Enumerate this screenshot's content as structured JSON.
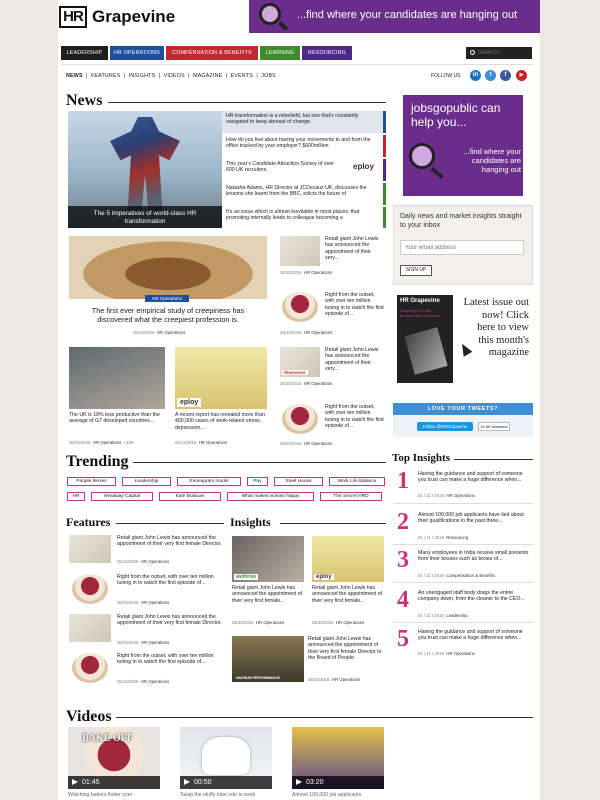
{
  "header": {
    "logo_hr": "HR",
    "logo_name": "Grapevine",
    "banner_text": "...find where your candidates are hanging out"
  },
  "nav": {
    "items": [
      "LEADERSHIP",
      "HR OPERATIONS",
      "COMPENSATION & BENEFITS",
      "LEARNING",
      "RESOURCING"
    ],
    "search_placeholder": "SEARCH..."
  },
  "subnav": {
    "items": [
      "NEWS",
      "FEATURES",
      "INSIGHTS",
      "VIDEOS",
      "MAGAZINE",
      "EVENTS",
      "JOBS"
    ],
    "follow_label": "FOLLOW US",
    "social": [
      "in",
      "t",
      "f",
      "▶"
    ]
  },
  "news": {
    "title": "News",
    "hero_caption": "The 5 imperatives of world-class HR transformation",
    "list": [
      "HR transformation is a minefield, but one that's constantly navigated to keep abreast of change.",
      "How do you feel about having your movements to and from the office tracked by your employer? $600million",
      "This year's Candidate Attraction Survey of over 600 UK recruiters.",
      "Natasha Adams, HR Director at JCDecaux UK, discusses the lessons she learnt from the BBC, edicts the future of",
      "It's an issue which is almost inevitable in most places; that promoting internally leads to colleague becoming a"
    ],
    "eploy_logo": "eploy",
    "bear_tag": "HR Operations",
    "bear_title": "The first ever empirical study of creepiness has discovered what the creepiest profession is.",
    "bear_date": "26/10/2016",
    "bear_cat": "HR Operations",
    "small_left": [
      {
        "text": "The UK is 18% less productive than the average of G7 developed countries...",
        "date": "26/10/2016",
        "cat": "HR Operations",
        "shares": "100"
      },
      {
        "text": "A recent report has revealed more than 400,000 cases of work-related stress, depression...",
        "date": "01/11/2016",
        "cat": "HR Operations",
        "logo": "eploy"
      }
    ],
    "side_list": [
      {
        "text": "Retail giant John Lewis has announced the appointment of their very...",
        "date": "26/10/2016",
        "cat": "HR Operations"
      },
      {
        "text": "Right from the outset, with over ten million tuning in to watch the first episode of...",
        "date": "26/10/2016",
        "cat": "HR Operations"
      },
      {
        "text": "Retail giant John Lewis has announced the appointment of their very...",
        "date": "26/10/2016",
        "cat": "HR Operations",
        "logo": "thomsons"
      },
      {
        "text": "Right from the outset, with over ten million tuning in to watch the first episode of...",
        "date": "26/10/2016",
        "cat": "HR Operations"
      }
    ]
  },
  "sidebar": {
    "ad_title": "jobsgopublic can help you...",
    "ad_text": "...find where your candidates are hanging out",
    "newsletter_title": "Daily news and market insights straight to your inbox",
    "email_placeholder": "Your email address",
    "signup_label": "SIGN UP",
    "mag_title": "HR Grapevine",
    "mag_cover_text": "Adapting to a four-generational workforce",
    "mag_text": "Latest issue out now! Click here to view this month's magazine",
    "tweets_label": "LOVE YOUR TWEETS?",
    "follow_btn": "Follow @HRGrapevine",
    "followers": "42.6K followers"
  },
  "trending": {
    "title": "Trending",
    "tags": [
      "People Moves",
      "Leadership",
      "Enneagram model",
      "Pay",
      "Steel House",
      "Work Life Balance",
      "HR",
      "Headway Capital",
      "Kate Bolduan",
      "What makes women happy",
      "The Secret HRD"
    ]
  },
  "top_insights": {
    "title": "Top Insights",
    "items": [
      {
        "num": "1",
        "text": "Having the guidance and support of someone you trust can make a huge difference when...",
        "date": "01 / 11 / 2016",
        "cat": "HR Operations"
      },
      {
        "num": "2",
        "text": "Almost 100,000 job applicants have lied about their qualifications in the past three...",
        "date": "01 / 11 / 2016",
        "cat": "Resourcing"
      },
      {
        "num": "3",
        "text": "Many employees in India receive small presents from their bosses such as boxes of...",
        "date": "01 / 11 / 2016",
        "cat": "Compensation & Benefits"
      },
      {
        "num": "4",
        "text": "An unengaged staff body drags the entire company down, from the cleaner to the CEO...",
        "date": "01 / 11 / 2016",
        "cat": "Leadership"
      },
      {
        "num": "5",
        "text": "Having the guidance and support of someone you trust can make a huge difference when...",
        "date": "01 / 11 / 2016",
        "cat": "HR Operations"
      }
    ]
  },
  "features": {
    "title": "Features",
    "items": [
      {
        "text": "Retail giant John Lewis has announced the appointment of their very first female Director.",
        "date": "26/10/2016",
        "cat": "HR Operations"
      },
      {
        "text": "Right from the outset, with over ten million tuning in to watch the first episode of...",
        "date": "26/10/2016",
        "cat": "HR Operations"
      },
      {
        "text": "Retail giant John Lewis has announced the appointment of their very first female Director.",
        "date": "26/10/2016",
        "cat": "HR Operations"
      },
      {
        "text": "Right from the outset, with over ten million tuning in to watch the first episode of...",
        "date": "26/10/2016",
        "cat": "HR Operations"
      }
    ]
  },
  "insights": {
    "title": "Insights",
    "items": [
      {
        "text": "Retail giant John Lewis has announced the appointment of their very first female...",
        "date": "26/10/2016",
        "cat": "HR Operations",
        "logo": "wethrive"
      },
      {
        "text": "Retail giant John Lewis has announced the appointment of their very first female...",
        "date": "26/10/2016",
        "cat": "HR Operations",
        "logo": "eploy"
      },
      {
        "text": "Retail giant John Lewis has announced the appointment of their very first female Director to the Board of People.",
        "date": "26/10/2016",
        "cat": "HR Operations",
        "logo": "NADRUM PERFORMANCE"
      }
    ]
  },
  "videos": {
    "title": "Videos",
    "items": [
      {
        "time": "01:45",
        "caption": "Watching bakers flutter over",
        "overlay": "BAKE OFF"
      },
      {
        "time": "00:50",
        "caption": "Swap the stuffy tube ride to work"
      },
      {
        "time": "03:20",
        "caption": "Almost 100,000 job applicants"
      }
    ]
  },
  "colors": {
    "nav": [
      "#1e1e1e",
      "#1c4f9c",
      "#c4282f",
      "#3f8a2c",
      "#4b2a8c"
    ],
    "accent": "#c8337a",
    "ad_purple": "#6b2d8c",
    "twitter": "#3d8fd6"
  }
}
